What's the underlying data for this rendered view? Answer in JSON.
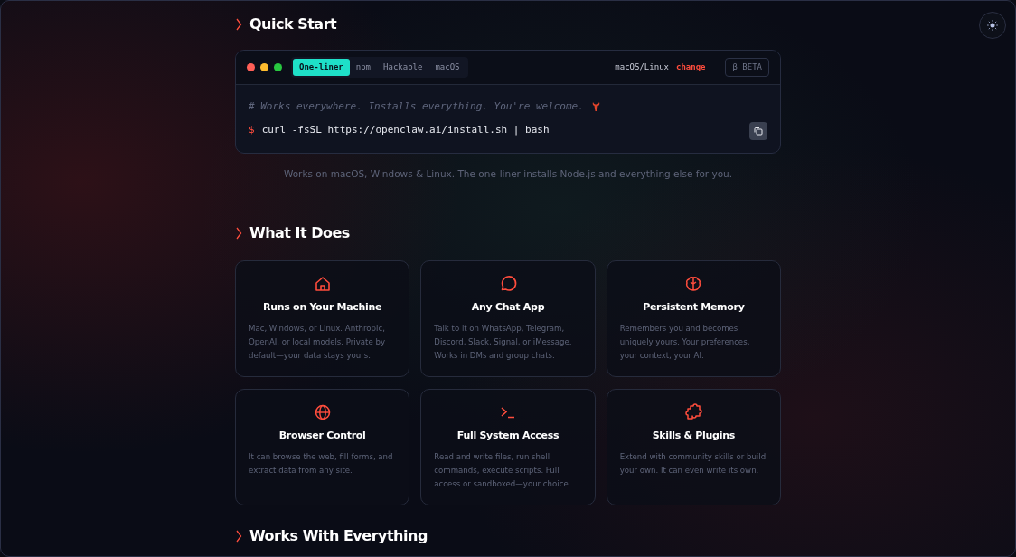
{
  "quick_start": {
    "title": "Quick Start",
    "tabs": [
      {
        "label": "One-liner",
        "selected": true
      },
      {
        "label": "npm",
        "selected": false
      },
      {
        "label": "Hackable",
        "selected": false
      },
      {
        "label": "macOS",
        "selected": false
      }
    ],
    "os_label": "macOS/Linux",
    "change_link": "change",
    "beta_button": "β BETA",
    "comment": "# Works everywhere. Installs everything. You're welcome.",
    "prompt": "$",
    "command": "curl -fsSL https://openclaw.ai/install.sh | bash",
    "note": "Works on macOS, Windows & Linux. The one-liner installs Node.js and everything else for you."
  },
  "what_it_does": {
    "title": "What It Does",
    "features": [
      {
        "kind": "house",
        "title": "Runs on Your Machine",
        "text": "Mac, Windows, or Linux. Anthropic, OpenAI, or local models. Private by default—your data stays yours."
      },
      {
        "kind": "chat",
        "title": "Any Chat App",
        "text": "Talk to it on WhatsApp, Telegram, Discord, Slack, Signal, or iMessage. Works in DMs and group chats."
      },
      {
        "kind": "brain",
        "title": "Persistent Memory",
        "text": "Remembers you and becomes uniquely yours. Your preferences, your context, your AI."
      },
      {
        "kind": "globe",
        "title": "Browser Control",
        "text": "It can browse the web, fill forms, and extract data from any site."
      },
      {
        "kind": "terminal",
        "title": "Full System Access",
        "text": "Read and write files, run shell commands, execute scripts. Full access or sandboxed—your choice."
      },
      {
        "kind": "puzzle",
        "title": "Skills & Plugins",
        "text": "Extend with community skills or build your own. It can even write its own."
      }
    ]
  },
  "works_with": {
    "title": "Works With Everything"
  }
}
